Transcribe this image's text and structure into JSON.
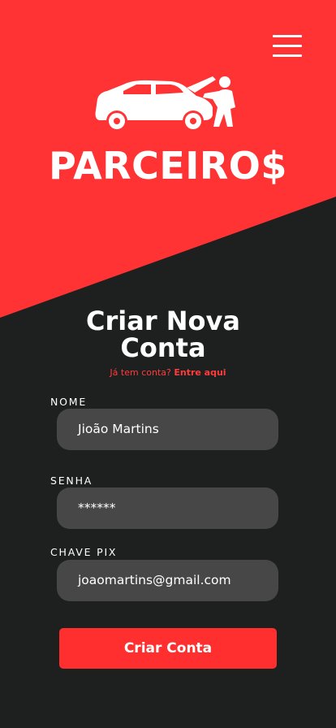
{
  "header": {
    "brand_name": "PARCEIRO$",
    "menu_icon": "hamburger-menu-icon",
    "logo_icon": "car-mechanic-icon",
    "accent_color": "#ff2f2f",
    "background_color": "#1e2020"
  },
  "form": {
    "title_line1": "Criar Nova",
    "title_line2": "Conta",
    "login_prompt": "Já tem conta?",
    "login_link": "Entre aqui",
    "fields": [
      {
        "label": "NOME",
        "value": "Jioão Martins"
      },
      {
        "label": "SENHA",
        "value": "******"
      },
      {
        "label": "CHAVE PIX",
        "value": "joaomartins@gmail.com"
      }
    ],
    "submit_label": "Criar Conta"
  }
}
